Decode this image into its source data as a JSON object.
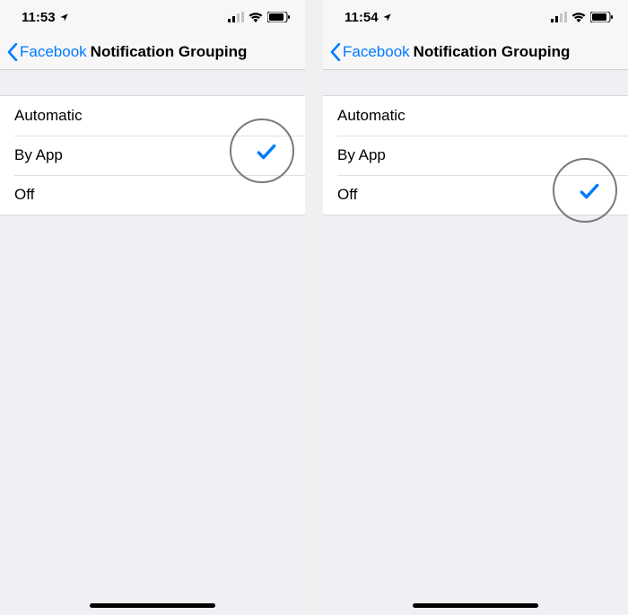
{
  "screens": [
    {
      "status": {
        "time": "11:53"
      },
      "nav": {
        "back_label": "Facebook",
        "title": "Notification Grouping"
      },
      "options": [
        {
          "label": "Automatic",
          "selected": false
        },
        {
          "label": "By App",
          "selected": true
        },
        {
          "label": "Off",
          "selected": false
        }
      ],
      "highlight_row_index": 1
    },
    {
      "status": {
        "time": "11:54"
      },
      "nav": {
        "back_label": "Facebook",
        "title": "Notification Grouping"
      },
      "options": [
        {
          "label": "Automatic",
          "selected": false
        },
        {
          "label": "By App",
          "selected": false
        },
        {
          "label": "Off",
          "selected": true
        }
      ],
      "highlight_row_index": 2
    }
  ],
  "colors": {
    "accent": "#007aff"
  }
}
